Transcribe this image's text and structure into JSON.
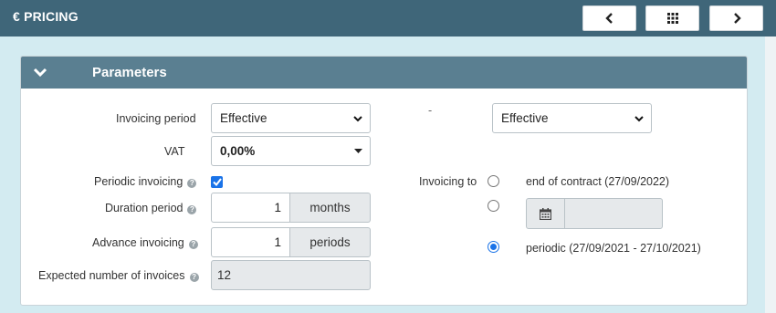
{
  "header": {
    "title": "€ PRICING",
    "prev_icon": "chevron-left-icon",
    "grid_icon": "grid-icon",
    "next_icon": "chevron-right-icon"
  },
  "panel": {
    "title": "Parameters",
    "collapse_icon": "chevron-down-icon"
  },
  "form": {
    "invoicing_period": {
      "label": "Invoicing period",
      "value": "Effective"
    },
    "dash": "-",
    "second_period": {
      "value": "Effective"
    },
    "vat": {
      "label": "VAT",
      "value": "0,00%"
    },
    "periodic_invoicing": {
      "label": "Periodic invoicing",
      "checked": true
    },
    "duration_period": {
      "label": "Duration period",
      "value": "1",
      "unit": "months"
    },
    "advance_invoicing": {
      "label": "Advance invoicing",
      "value": "1",
      "unit": "periods"
    },
    "expected_invoices": {
      "label": "Expected number of invoices",
      "value": "12"
    },
    "invoicing_to": {
      "label": "Invoicing to",
      "options": [
        {
          "label": "end of contract (27/09/2022)",
          "checked": false
        },
        {
          "label": "",
          "checked": false,
          "date_value": ""
        },
        {
          "label": "periodic (27/09/2021 - 27/10/2021)",
          "checked": true
        }
      ]
    }
  },
  "colors": {
    "topbar": "#3f6679",
    "panel_header": "#5a7f91",
    "background": "#d3ebf1",
    "accent": "#1a73e8"
  }
}
